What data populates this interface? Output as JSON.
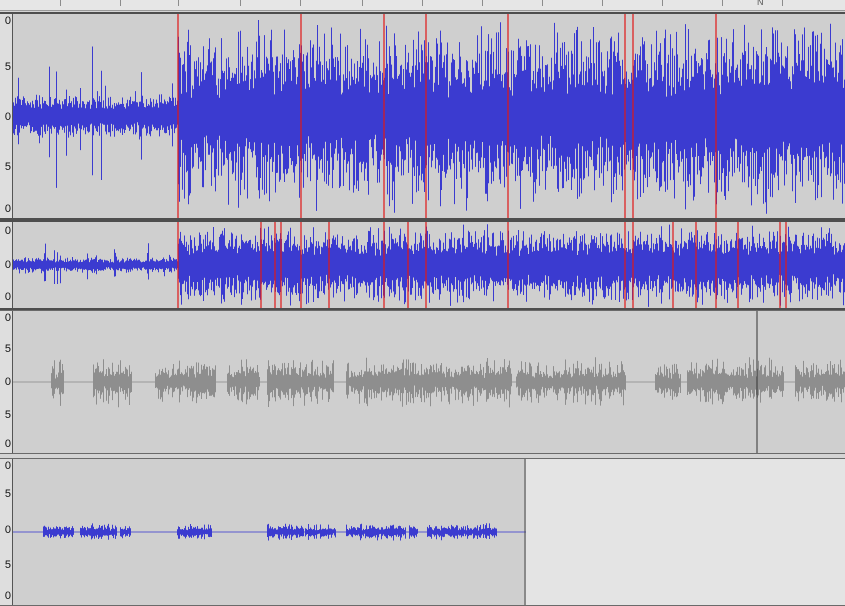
{
  "timeline": {
    "label": "N"
  },
  "tracks": [
    {
      "id": "track-1",
      "scale_labels": [
        "0",
        "5",
        "0",
        "5",
        "0"
      ],
      "wave_color": "#3b3bd0",
      "clip_color": "#e01818",
      "selected": true
    },
    {
      "id": "track-2",
      "scale_labels": [
        "0",
        "0",
        "0"
      ],
      "wave_color": "#3b3bd0",
      "clip_color": "#e01818",
      "selected": true
    },
    {
      "id": "track-3",
      "scale_labels": [
        "0",
        "5",
        "0",
        "5",
        "0"
      ],
      "wave_color": "#8e8e8e",
      "selected": false
    },
    {
      "id": "track-4",
      "scale_labels": [
        "0",
        "5",
        "0",
        "5",
        "0"
      ],
      "wave_color": "#3b3bd0",
      "selected": false
    }
  ],
  "colors": {
    "track_bg": "#cfcfcf",
    "empty_bg": "#e4e4e4",
    "ruler_bg": "#e6e6e6"
  }
}
